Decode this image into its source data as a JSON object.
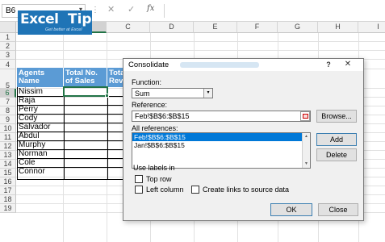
{
  "formula_bar": {
    "name_box": "B6",
    "name_box_arrow": "▾",
    "separator": "⋮",
    "cancel": "✕",
    "enter": "✓",
    "fx": "fx",
    "formula": ""
  },
  "columns": [
    "A",
    "B",
    "C",
    "D",
    "E",
    "F",
    "G",
    "H",
    "I"
  ],
  "rows": [
    "1",
    "2",
    "3",
    "4",
    "5",
    "6",
    "7",
    "8",
    "9",
    "10",
    "11",
    "12",
    "13",
    "14",
    "15",
    "16",
    "17",
    "18",
    "19"
  ],
  "logo": {
    "excel": "Excel",
    "tip": "Tip",
    "tagline": "Get better at Excel"
  },
  "table": {
    "headers": [
      "Agents Name",
      "Total No. of Sales",
      "Tota Rev"
    ],
    "agents": [
      "Nissim",
      "Raja",
      "Perry",
      "Cody",
      "Salvador",
      "Abdul",
      "Murphy",
      "Norman",
      "Cole",
      "Connor"
    ]
  },
  "dialog": {
    "title": "Consolidate",
    "help": "?",
    "close": "✕",
    "function_label": "Function:",
    "function_value": "Sum",
    "function_arrow": "▾",
    "reference_label": "Reference:",
    "reference_value": "Feb!$B$6:$B$15",
    "browse": "Browse...",
    "all_references_label": "All references:",
    "all_references": [
      "Feb!$B$6:$B$15",
      "Jan!$B$6:$B$15"
    ],
    "scroll_up": "▲",
    "scroll_down": "▼",
    "add": "Add",
    "delete": "Delete",
    "use_labels_in": "Use labels in",
    "top_row": "Top row",
    "left_column": "Left column",
    "create_links": "Create links to source data",
    "ok": "OK",
    "close_button": "Close"
  },
  "colors": {
    "header_fill": "#5b9bd5",
    "logo_fill": "#1f74b6",
    "selection": "#217346",
    "list_selection": "#0078d7"
  }
}
